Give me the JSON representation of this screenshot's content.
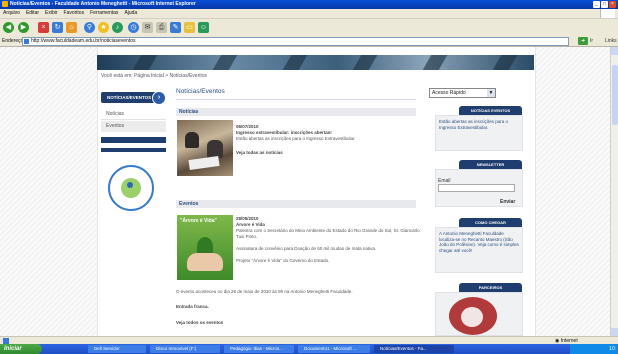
{
  "window": {
    "title": "Notícias/Eventos - Faculdade Antonio Meneghetti - Microsoft Internet Explorer"
  },
  "menu": [
    "Arquivo",
    "Editar",
    "Exibir",
    "Favoritos",
    "Ferramentas",
    "Ajuda"
  ],
  "address": {
    "label": "Endereço",
    "url": "http://www.faculdadeam.edu.br/noticiaseventos",
    "go_label": "Ir",
    "links_label": "Links"
  },
  "page": {
    "breadcrumb": "Você está em: Página Inicial > Notícias/Eventos",
    "nav": {
      "header": "NOTÍCIAS/EVENTOS",
      "items": [
        "Notícias",
        "Eventos"
      ]
    },
    "main": {
      "title": "Notícias/Eventos",
      "noticias": {
        "section_label": "Notícias",
        "date": "06/07/2010",
        "headline": "Ingresso extravestibular: inscrições abertas!",
        "summary": "Estão abertas as inscrições para o Ingresso Extravestibular.",
        "see_all": "Veja todas as notícias"
      },
      "eventos": {
        "section_label": "Eventos",
        "date": "28/05/2010",
        "headline": "Árvore é Vida",
        "line1": "Palestra com o Secretário do Meio Ambiente do Estado do Rio Grande do Sul, Sr. Giancarlo Tusi Pinto.",
        "line2": "Assinatura de convênio para Doação de 60 mil mudas de mata nativa.",
        "line3": "Projeto \"Árvore é Vida\" do Governo do Estado.",
        "line4": "O evento aconteceu no dia 28 de maio de 2010 às 9h na Antonio Meneghetti Faculdade.",
        "entry": "Entrada franca.",
        "see_all": "Veja todos os eventos",
        "image_text": "\"Árvore é Vida\""
      }
    },
    "right": {
      "quick_access": "Acesso Rápido",
      "noticias_eventos_header": "NOTÍCIAS EVENTOS",
      "noticias_eventos_text": "Estão abertas as inscrições para o Ingresso Extravestibular.",
      "newsletter_header": "NEWSLETTER",
      "email_label": "Email",
      "submit_label": "Enviar",
      "como_chegar_header": "COMO CHEGAR",
      "como_chegar_text": "A Antonio Meneghetti Faculdade localiza-se no Recanto Maestro (São João do Polêsine). Veja como é simples chegar até você!",
      "parceiros_header": "PARCEIROS"
    }
  },
  "status": {
    "zone": "Internet"
  },
  "taskbar": {
    "start": "Iniciar",
    "items": [
      "Dell Servidor",
      "Disco removível (F:)",
      "Pedagógio 'dias - Micros...",
      "Documento1 - Microsoft ...",
      "Notícias/Eventos - Fa..."
    ],
    "clock": "10:"
  }
}
